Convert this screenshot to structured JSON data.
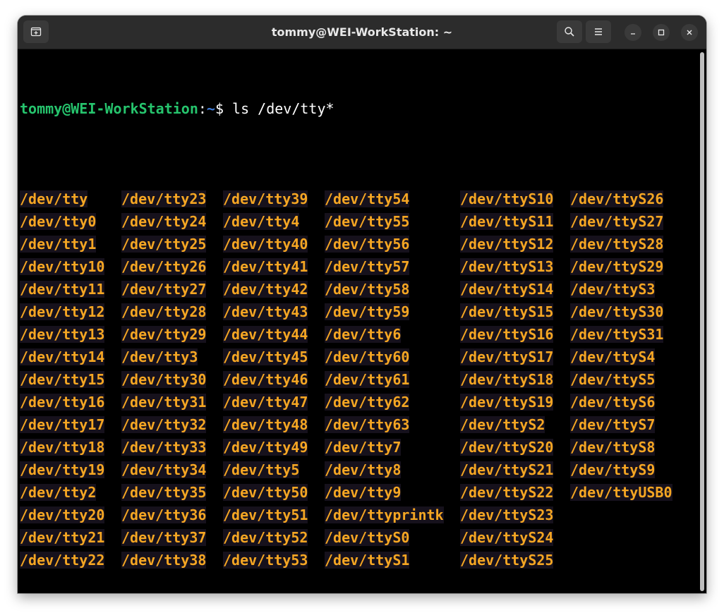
{
  "window": {
    "title": "tommy@WEI-WorkStation: ~"
  },
  "icons": {
    "new_tab": "new-tab-icon",
    "search": "search-icon",
    "menu": "hamburger-menu-icon",
    "minimize": "minimize-icon",
    "maximize": "maximize-icon",
    "close": "close-icon"
  },
  "colors": {
    "prompt_user": "#26c46d",
    "prompt_path": "#3f7bd6",
    "file_text": "#f5a623",
    "file_bg": "#16111c",
    "terminal_bg": "#000000",
    "titlebar_bg": "#2c2c2c"
  },
  "prompt": {
    "user_host": "tommy@WEI-WorkStation",
    "colon": ":",
    "path": "~",
    "dollar": "$"
  },
  "command": " ls /dev/tty*",
  "listing": {
    "columns": [
      [
        "/dev/tty",
        "/dev/tty0",
        "/dev/tty1",
        "/dev/tty10",
        "/dev/tty11",
        "/dev/tty12",
        "/dev/tty13",
        "/dev/tty14",
        "/dev/tty15",
        "/dev/tty16",
        "/dev/tty17",
        "/dev/tty18",
        "/dev/tty19",
        "/dev/tty2",
        "/dev/tty20",
        "/dev/tty21",
        "/dev/tty22"
      ],
      [
        "/dev/tty23",
        "/dev/tty24",
        "/dev/tty25",
        "/dev/tty26",
        "/dev/tty27",
        "/dev/tty28",
        "/dev/tty29",
        "/dev/tty3",
        "/dev/tty30",
        "/dev/tty31",
        "/dev/tty32",
        "/dev/tty33",
        "/dev/tty34",
        "/dev/tty35",
        "/dev/tty36",
        "/dev/tty37",
        "/dev/tty38"
      ],
      [
        "/dev/tty39",
        "/dev/tty4",
        "/dev/tty40",
        "/dev/tty41",
        "/dev/tty42",
        "/dev/tty43",
        "/dev/tty44",
        "/dev/tty45",
        "/dev/tty46",
        "/dev/tty47",
        "/dev/tty48",
        "/dev/tty49",
        "/dev/tty5",
        "/dev/tty50",
        "/dev/tty51",
        "/dev/tty52",
        "/dev/tty53"
      ],
      [
        "/dev/tty54",
        "/dev/tty55",
        "/dev/tty56",
        "/dev/tty57",
        "/dev/tty58",
        "/dev/tty59",
        "/dev/tty6",
        "/dev/tty60",
        "/dev/tty61",
        "/dev/tty62",
        "/dev/tty63",
        "/dev/tty7",
        "/dev/tty8",
        "/dev/tty9",
        "/dev/ttyprintk",
        "/dev/ttyS0",
        "/dev/ttyS1"
      ],
      [
        "/dev/ttyS10",
        "/dev/ttyS11",
        "/dev/ttyS12",
        "/dev/ttyS13",
        "/dev/ttyS14",
        "/dev/ttyS15",
        "/dev/ttyS16",
        "/dev/ttyS17",
        "/dev/ttyS18",
        "/dev/ttyS19",
        "/dev/ttyS2",
        "/dev/ttyS20",
        "/dev/ttyS21",
        "/dev/ttyS22",
        "/dev/ttyS23",
        "/dev/ttyS24",
        "/dev/ttyS25"
      ],
      [
        "/dev/ttyS26",
        "/dev/ttyS27",
        "/dev/ttyS28",
        "/dev/ttyS29",
        "/dev/ttyS3",
        "/dev/ttyS30",
        "/dev/ttyS31",
        "/dev/ttyS4",
        "/dev/ttyS5",
        "/dev/ttyS6",
        "/dev/ttyS7",
        "/dev/ttyS8",
        "/dev/ttyS9",
        "/dev/ttyUSB0"
      ]
    ]
  }
}
